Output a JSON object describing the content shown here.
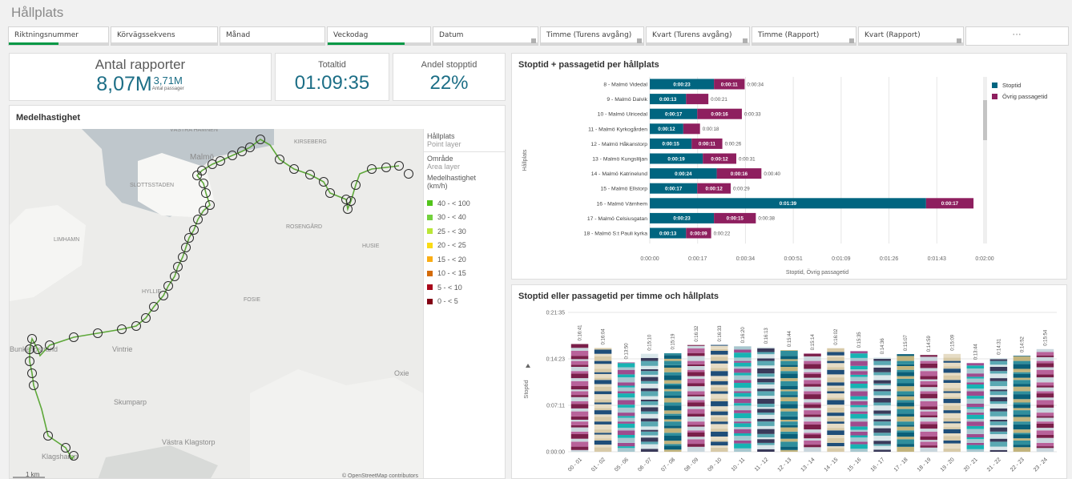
{
  "sheet": {
    "title": "Hållplats"
  },
  "filters": [
    {
      "label": "Riktningsnummer",
      "progress": 0.5
    },
    {
      "label": "Körvägssekvens",
      "progress": 0
    },
    {
      "label": "Månad",
      "progress": 0
    },
    {
      "label": "Veckodag",
      "progress": 0.75
    },
    {
      "label": "Datum",
      "progress": 0
    },
    {
      "label": "Timme (Turens avgång)",
      "progress": 0
    },
    {
      "label": "Kvart (Turens avgång)",
      "progress": 0
    },
    {
      "label": "Timme (Rapport)",
      "progress": 0
    },
    {
      "label": "Kvart (Rapport)",
      "progress": 0
    },
    {
      "label": "···",
      "progress": 0
    }
  ],
  "kpis": {
    "rapporter": {
      "label": "Antal rapporter",
      "value": "8,07M",
      "sub_value": "3,71M",
      "sub_label": "Antal passager"
    },
    "totaltid": {
      "label": "Totaltid",
      "value": "01:09:35"
    },
    "andel": {
      "label": "Andel stopptid",
      "value": "22%"
    }
  },
  "map": {
    "title": "Medelhastighet",
    "place_labels": [
      "VÄSTRA HAMNEN",
      "Malmö",
      "KIRSEBERG",
      "SLOTTSSTADEN",
      "ROSENGÅRD",
      "HUSIE",
      "LIMHAMN",
      "HYLLIE",
      "FOSIE",
      "Vintrie",
      "Oxie",
      "Skumparp",
      "Västra Klagstorp",
      "Klagshamn",
      "Bunkeflostrand"
    ],
    "scale": "1 km",
    "attribution": "© OpenStreetMap contributors",
    "legend": {
      "layer1_title": "Hållplats",
      "layer1_sub": "Point layer",
      "layer2_title": "Område",
      "layer2_sub": "Area layer",
      "measure_title": "Medelhastighet (km/h)",
      "items": [
        {
          "label": "40 - < 100",
          "color": "#52c41a"
        },
        {
          "label": "30 - < 40",
          "color": "#73d13d"
        },
        {
          "label": "25 - < 30",
          "color": "#bae637"
        },
        {
          "label": "20 - < 25",
          "color": "#fadb14"
        },
        {
          "label": "15 - < 20",
          "color": "#faad14"
        },
        {
          "label": "10 - < 15",
          "color": "#d46b08"
        },
        {
          "label": "5 - < 10",
          "color": "#a8071a"
        },
        {
          "label": "0 - < 5",
          "color": "#820014"
        }
      ]
    }
  },
  "colors": {
    "stoptid": "#006580",
    "ovrig": "#8e1f5f",
    "accent": "#1c6e86",
    "green": "#009845"
  },
  "chart_data": [
    {
      "type": "bar",
      "orientation": "horizontal",
      "stacked": true,
      "title": "Stoptid + passagetid per hållplats",
      "ylabel": "Hållplats",
      "xlabel": "Stoptid, Övrig passagetid",
      "x_ticks": [
        "0:00:00",
        "0:00:17",
        "0:00:34",
        "0:00:51",
        "0:01:09",
        "0:01:26",
        "0:01:43",
        "0:02:00"
      ],
      "xlim_seconds": [
        0,
        120
      ],
      "legend_position": "right",
      "categories": [
        "8 - Malmö Videdal",
        "9 - Malmö Dalvik",
        "10 - Malmö Ulricedal",
        "11 - Malmö Kyrkogården",
        "12 - Malmö Håkanstorp",
        "13 - Malmö Kungsliljan",
        "14 - Malmö Katrinelund",
        "15 - Malmö Ellstorp",
        "16 - Malmö Värnhem",
        "17 - Malmö Celsiusgatan",
        "18 - Malmö S:t Pauli kyrka"
      ],
      "series": [
        {
          "name": "Stoptid",
          "values_seconds": [
            23,
            13,
            17,
            12,
            15,
            19,
            24,
            17,
            99,
            23,
            13
          ],
          "labels": [
            "0:00:23",
            "0:00:13",
            "0:00:17",
            "0:00:12",
            "0:00:15",
            "0:00:19",
            "0:00:24",
            "0:00:17",
            "0:01:39",
            "0:00:23",
            "0:00:13"
          ]
        },
        {
          "name": "Övrig passagetid",
          "values_seconds": [
            11,
            8,
            16,
            6,
            11,
            12,
            16,
            12,
            17,
            15,
            9
          ],
          "labels": [
            "0:00:11",
            "",
            "0:00:16",
            "",
            "0:00:11",
            "0:00:12",
            "0:00:16",
            "0:00:12",
            "0:00:17",
            "0:00:15",
            "0:00:09"
          ]
        }
      ],
      "totals": [
        "0:00:34",
        "0:00:21",
        "0:00:33",
        "0:00:18",
        "0:00:26",
        "0:00:31",
        "0:00:40",
        "0:00:29",
        "",
        "0:00:38",
        "0:00:22"
      ]
    },
    {
      "type": "bar",
      "stacked": true,
      "title": "Stoptid eller passagetid per timme och hållplats",
      "ylabel": "Stoptid",
      "y_ticks": [
        "0:00:00",
        "0:07:11",
        "0:14:23",
        "0:21:35"
      ],
      "ylim_seconds": [
        0,
        1295
      ],
      "categories": [
        "00 - 01",
        "01 - 02",
        "05 - 06",
        "06 - 07",
        "07 - 08",
        "08 - 09",
        "09 - 10",
        "10 - 11",
        "11 - 12",
        "12 - 13",
        "13 - 14",
        "14 - 15",
        "15 - 16",
        "16 - 17",
        "17 - 18",
        "18 - 19",
        "19 - 20",
        "20 - 21",
        "21 - 22",
        "22 - 23",
        "23 - 24"
      ],
      "totals": [
        "0:16:41",
        "0:16:04",
        "0:13:50",
        "0:15:10",
        "0:15:19",
        "0:16:32",
        "0:16:33",
        "0:16:20",
        "0:16:13",
        "0:15:44",
        "0:15:14",
        "0:16:02",
        "0:15:35",
        "0:14:36",
        "0:15:07",
        "0:14:59",
        "0:15:09",
        "0:13:44",
        "0:14:31",
        "0:14:52",
        "0:15:54"
      ],
      "totals_seconds": [
        1001,
        964,
        830,
        910,
        919,
        992,
        993,
        980,
        973,
        944,
        914,
        962,
        935,
        876,
        907,
        899,
        909,
        824,
        871,
        892,
        954
      ]
    }
  ]
}
